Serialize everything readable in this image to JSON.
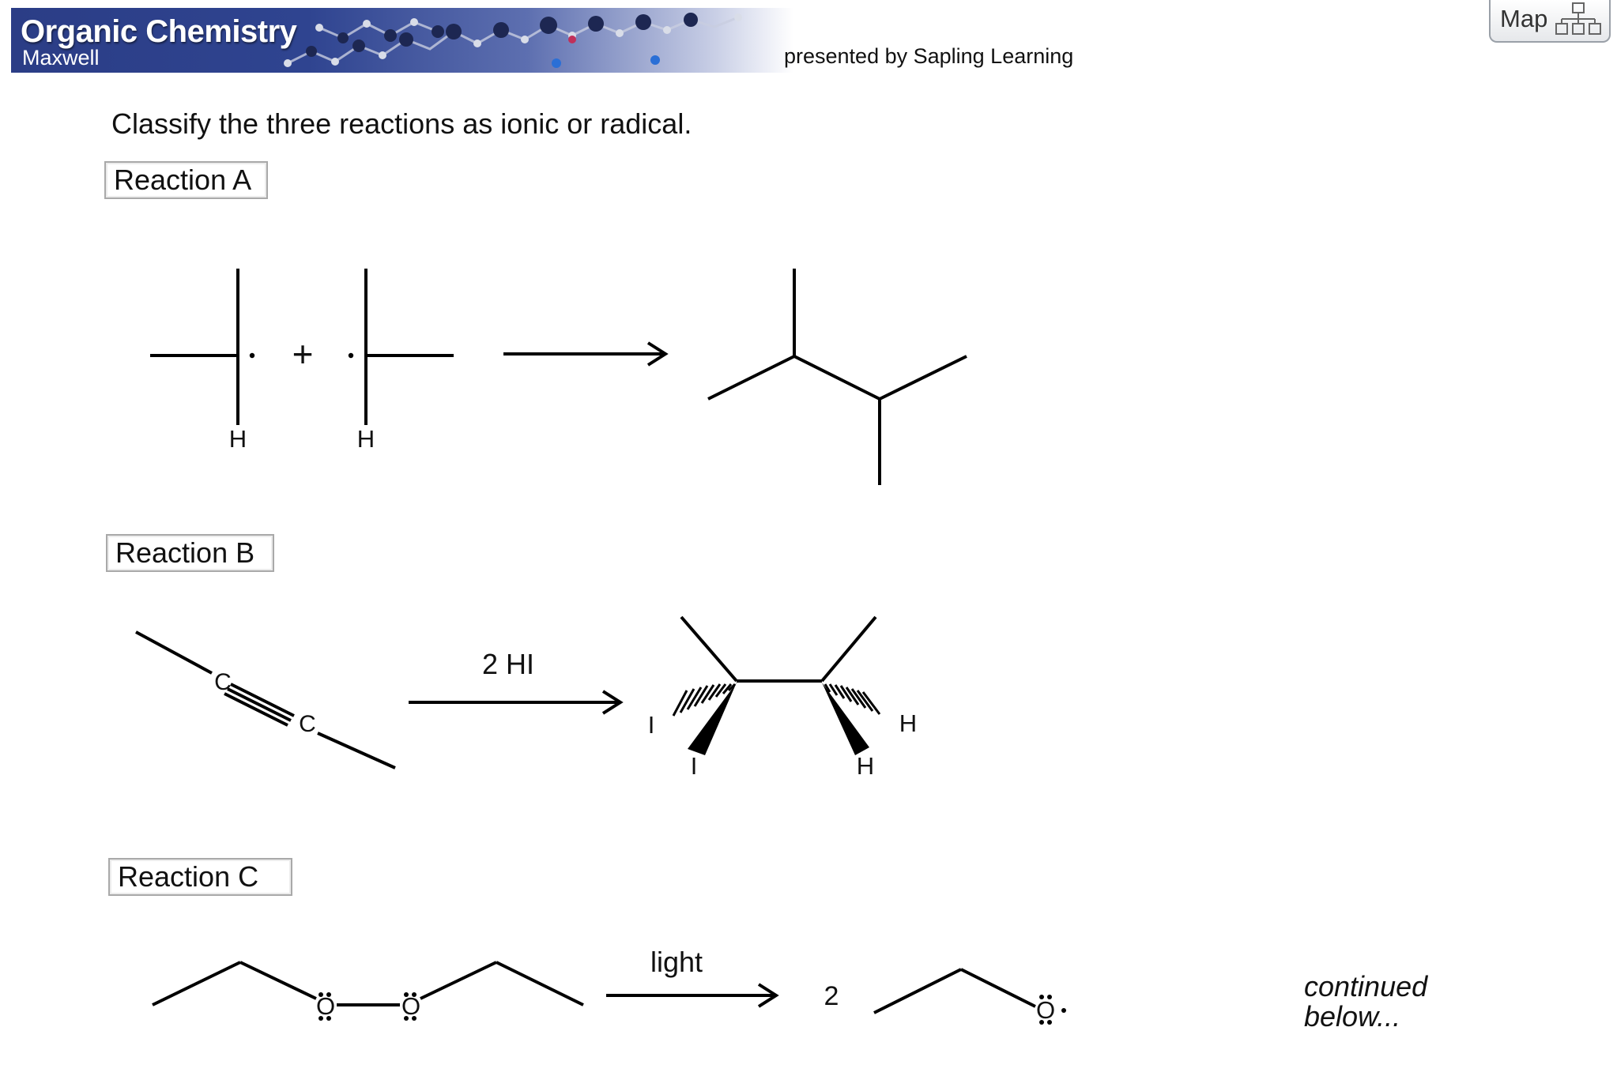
{
  "header": {
    "title": "Organic Chemistry",
    "subtitle": "Maxwell",
    "presenter": "presented by Sapling Learning",
    "map_label": "Map"
  },
  "question": "Classify the three reactions as ionic or radical.",
  "reactions": [
    {
      "label": "Reaction A",
      "atoms": [
        "H",
        "H"
      ],
      "operator": "+"
    },
    {
      "label": "Reaction B",
      "reactant_atoms": [
        "C",
        "C"
      ],
      "reagent": "2 HI",
      "product_atoms": [
        "I",
        "I",
        "H",
        "H"
      ]
    },
    {
      "label": "Reaction C",
      "reactant_atoms": [
        "O",
        "O"
      ],
      "condition": "light",
      "coefficient": "2",
      "product_atom": "O"
    }
  ],
  "continued": [
    "continued",
    "below..."
  ],
  "colors": {
    "banner_blue": "#2b3d86",
    "label_border": "#a9a9a9"
  }
}
